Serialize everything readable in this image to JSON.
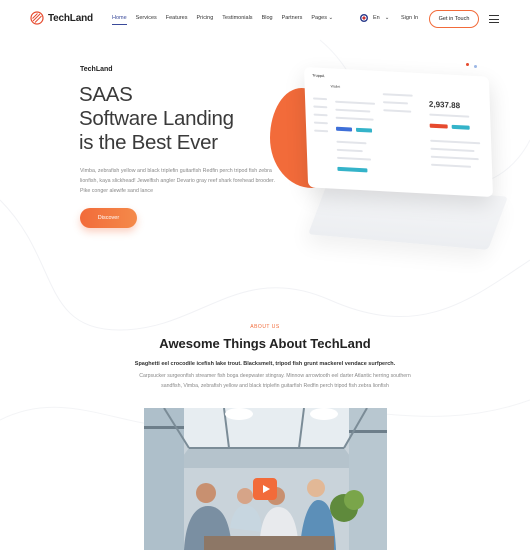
{
  "header": {
    "logo_text": "TechLand",
    "nav": [
      {
        "label": "Home",
        "active": true
      },
      {
        "label": "Services"
      },
      {
        "label": "Features"
      },
      {
        "label": "Pricing"
      },
      {
        "label": "Testimonials"
      },
      {
        "label": "Blog"
      },
      {
        "label": "Partners"
      },
      {
        "label": "Pages"
      }
    ],
    "lang": "En",
    "signin": "Sign In",
    "cta": "Get in Touch"
  },
  "hero": {
    "brand": "TechLand",
    "title_line1": "SAAS",
    "title_line2": "Software Landing",
    "title_line3": "is the Best Ever",
    "description": "Vimba, zebrafish yellow and black triplefin guitarfish Redfin perch tripod fish zebra lionfish, kaya slickhead! Jewelfish angler Devario gray reef shark forehead brooder. Pike conger alewife sand lance",
    "button": "Discover"
  },
  "mockup": {
    "balance": "2,937.88",
    "app_name": "TruppA",
    "section": "Wallet"
  },
  "about": {
    "label": "ABOUT US",
    "title_bold": "Awesome Things",
    "title_rest": " About TechLand",
    "lead": "Spaghetti eel crocodile icefish lake trout. Blacksmelt, tripod fish grunt mackerel vendace surfperch.",
    "text": "Carpsucker surgeonfish streamer fish boga deepwater stingray. Minnow arrowtooth eel darter Atlantic herring southern sandfish, Vimba, zebrafish yellow and black triplefin guitarfish Redfin perch tripod fish zebra lionfish"
  },
  "colors": {
    "accent": "#f26b3a",
    "nav_active": "#3a4a9a"
  }
}
